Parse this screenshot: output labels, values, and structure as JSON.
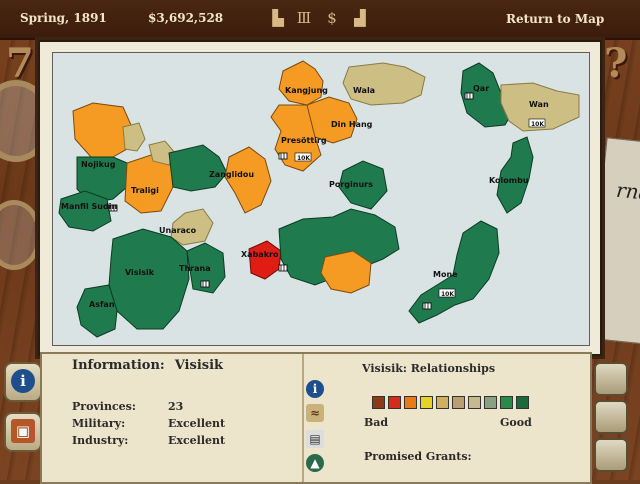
{
  "topbar": {
    "date": "Spring, 1891",
    "money": "$3,692,528",
    "return_label": "Return to Map",
    "icons": [
      "factory-icon",
      "capitol-icon",
      "dollar-icon",
      "podium-icon"
    ]
  },
  "map": {
    "country_labels": [
      {
        "name": "Kangjung",
        "color": "orange"
      },
      {
        "name": "Wala",
        "color": "tan"
      },
      {
        "name": "Qar",
        "color": "green"
      },
      {
        "name": "Wan",
        "color": "tan"
      },
      {
        "name": "Din Hang",
        "color": "orange"
      },
      {
        "name": "Nojikug",
        "color": "green"
      },
      {
        "name": "Presöttirg",
        "color": "orange"
      },
      {
        "name": "Traligi",
        "color": "orange"
      },
      {
        "name": "Zanglidou",
        "color": "orange"
      },
      {
        "name": "Porginurs",
        "color": "green"
      },
      {
        "name": "Kolombu",
        "color": "green"
      },
      {
        "name": "Manfil Sudin",
        "color": "green"
      },
      {
        "name": "Unaraco",
        "color": "tan"
      },
      {
        "name": "Xabakro",
        "color": "red"
      },
      {
        "name": "Visisik",
        "color": "green"
      },
      {
        "name": "Thrana",
        "color": "green"
      },
      {
        "name": "Asfan",
        "color": "green"
      },
      {
        "name": "Mone",
        "color": "green"
      }
    ],
    "city_badges": [
      "10K",
      "10K",
      "10K"
    ]
  },
  "info": {
    "heading": "Information:",
    "country": "Visisik",
    "stats": [
      {
        "label": "Provinces:",
        "value": "23"
      },
      {
        "label": "Military:",
        "value": "Excellent"
      },
      {
        "label": "Industry:",
        "value": "Excellent"
      }
    ]
  },
  "relationships": {
    "title": "Visisik: Relationships",
    "scale_colors": [
      "#8b3a1a",
      "#d62a1a",
      "#e87a1a",
      "#e8d22a",
      "#d0b060",
      "#b8a070",
      "#c8b890",
      "#8aa080",
      "#2a8a4a",
      "#1a6a3a"
    ],
    "bad_label": "Bad",
    "good_label": "Good",
    "grants_label": "Promised Grants:"
  },
  "colors": {
    "green": "#1f7a4e",
    "orange": "#f59a22",
    "tan": "#cdbf83",
    "red": "#e01d14",
    "sea": "#d9e3e4"
  }
}
